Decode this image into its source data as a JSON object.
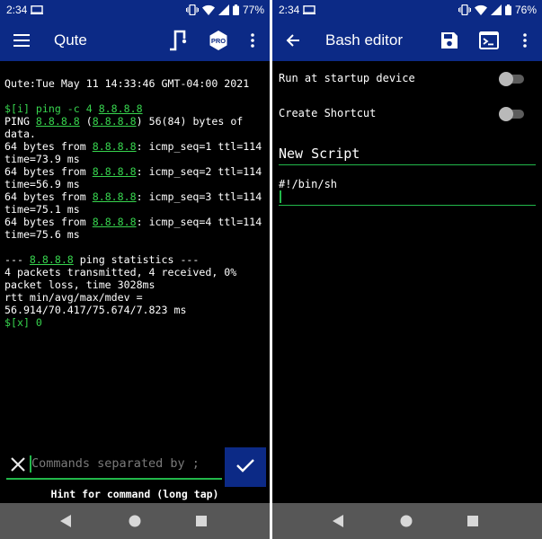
{
  "left_screen": {
    "status_bar": {
      "time": "2:34",
      "battery": "77%"
    },
    "app_bar": {
      "title": "Qute"
    },
    "terminal": {
      "lines": [
        [
          {
            "t": "Qute:Tue May 11 14:33:46 GMT-04:00 2021"
          }
        ],
        [],
        [
          {
            "t": "$[i] ping -c 4 ",
            "c": "g"
          },
          {
            "t": "8.8.8.8",
            "c": "g ul"
          }
        ],
        [
          {
            "t": "PING "
          },
          {
            "t": "8.8.8.8",
            "c": "g ul"
          },
          {
            "t": " ("
          },
          {
            "t": "8.8.8.8",
            "c": "g ul"
          },
          {
            "t": ") 56(84) bytes of"
          }
        ],
        [
          {
            "t": "data."
          }
        ],
        [
          {
            "t": "64 bytes from "
          },
          {
            "t": "8.8.8.8",
            "c": "g ul"
          },
          {
            "t": ": icmp_seq=1 ttl=114"
          }
        ],
        [
          {
            "t": "time=73.9 ms"
          }
        ],
        [
          {
            "t": "64 bytes from "
          },
          {
            "t": "8.8.8.8",
            "c": "g ul"
          },
          {
            "t": ": icmp_seq=2 ttl=114"
          }
        ],
        [
          {
            "t": "time=56.9 ms"
          }
        ],
        [
          {
            "t": "64 bytes from "
          },
          {
            "t": "8.8.8.8",
            "c": "g ul"
          },
          {
            "t": ": icmp_seq=3 ttl=114"
          }
        ],
        [
          {
            "t": "time=75.1 ms"
          }
        ],
        [
          {
            "t": "64 bytes from "
          },
          {
            "t": "8.8.8.8",
            "c": "g ul"
          },
          {
            "t": ": icmp_seq=4 ttl=114"
          }
        ],
        [
          {
            "t": "time=75.6 ms"
          }
        ],
        [],
        [
          {
            "t": "--- "
          },
          {
            "t": "8.8.8.8",
            "c": "g ul"
          },
          {
            "t": " ping statistics ---"
          }
        ],
        [
          {
            "t": "4 packets transmitted, 4 received, 0%"
          }
        ],
        [
          {
            "t": "packet loss, time 3028ms"
          }
        ],
        [
          {
            "t": "rtt min/avg/max/mdev ="
          }
        ],
        [
          {
            "t": "56.914/70.417/75.674/7.823 ms"
          }
        ],
        [
          {
            "t": "$[x] 0",
            "c": "g"
          }
        ]
      ]
    },
    "command_input": {
      "placeholder": "Commands separated by ;"
    },
    "hint": "Hint for command (long tap)"
  },
  "right_screen": {
    "status_bar": {
      "time": "2:34",
      "battery": "76%"
    },
    "app_bar": {
      "title": "Bash editor"
    },
    "settings": [
      {
        "label": "Run at startup device",
        "enabled": false
      },
      {
        "label": "Create Shortcut",
        "enabled": false
      }
    ],
    "script_name": "New Script",
    "script_body": "#!/bin/sh"
  },
  "colors": {
    "app_bar": "#0c2a86",
    "accent_green": "#37d44e",
    "background": "#000000",
    "nav_bar": "#575757"
  },
  "icons": {
    "left_app_bar": [
      "menu-icon",
      "route-icon",
      "pro-badge-icon",
      "more-vert-icon"
    ],
    "right_app_bar": [
      "back-arrow-icon",
      "save-icon",
      "terminal-icon",
      "more-vert-icon"
    ],
    "nav_bar": [
      "back-icon",
      "home-icon",
      "recents-icon"
    ]
  }
}
